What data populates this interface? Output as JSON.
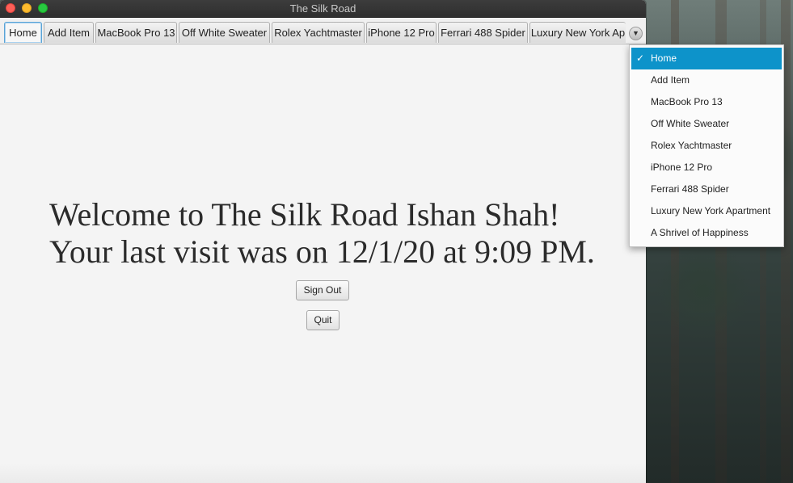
{
  "window": {
    "title": "The Silk Road"
  },
  "tabs": [
    {
      "label": "Home",
      "active": true
    },
    {
      "label": "Add Item"
    },
    {
      "label": "MacBook Pro 13"
    },
    {
      "label": "Off White Sweater"
    },
    {
      "label": "Rolex Yachtmaster"
    },
    {
      "label": "iPhone 12 Pro"
    },
    {
      "label": "Ferrari 488 Spider"
    },
    {
      "label": "Luxury New York Ap"
    }
  ],
  "tab_overflow_icon": "chevron-down-icon",
  "main": {
    "welcome_line": "Welcome to The Silk Road Ishan Shah!",
    "last_visit_line": "Your last visit was on 12/1/20 at 9:09 PM.",
    "sign_out_label": "Sign Out",
    "quit_label": "Quit"
  },
  "tab_menu": {
    "check_glyph": "✓",
    "items": [
      {
        "label": "Home",
        "selected": true
      },
      {
        "label": "Add Item"
      },
      {
        "label": "MacBook Pro 13"
      },
      {
        "label": "Off White Sweater"
      },
      {
        "label": "Rolex Yachtmaster"
      },
      {
        "label": "iPhone 12 Pro"
      },
      {
        "label": "Ferrari 488 Spider"
      },
      {
        "label": "Luxury New York Apartment"
      },
      {
        "label": "A Shrivel of Happiness"
      }
    ]
  },
  "colors": {
    "selection": "#0d93ca",
    "active_tab_border": "#5aa4d6"
  }
}
